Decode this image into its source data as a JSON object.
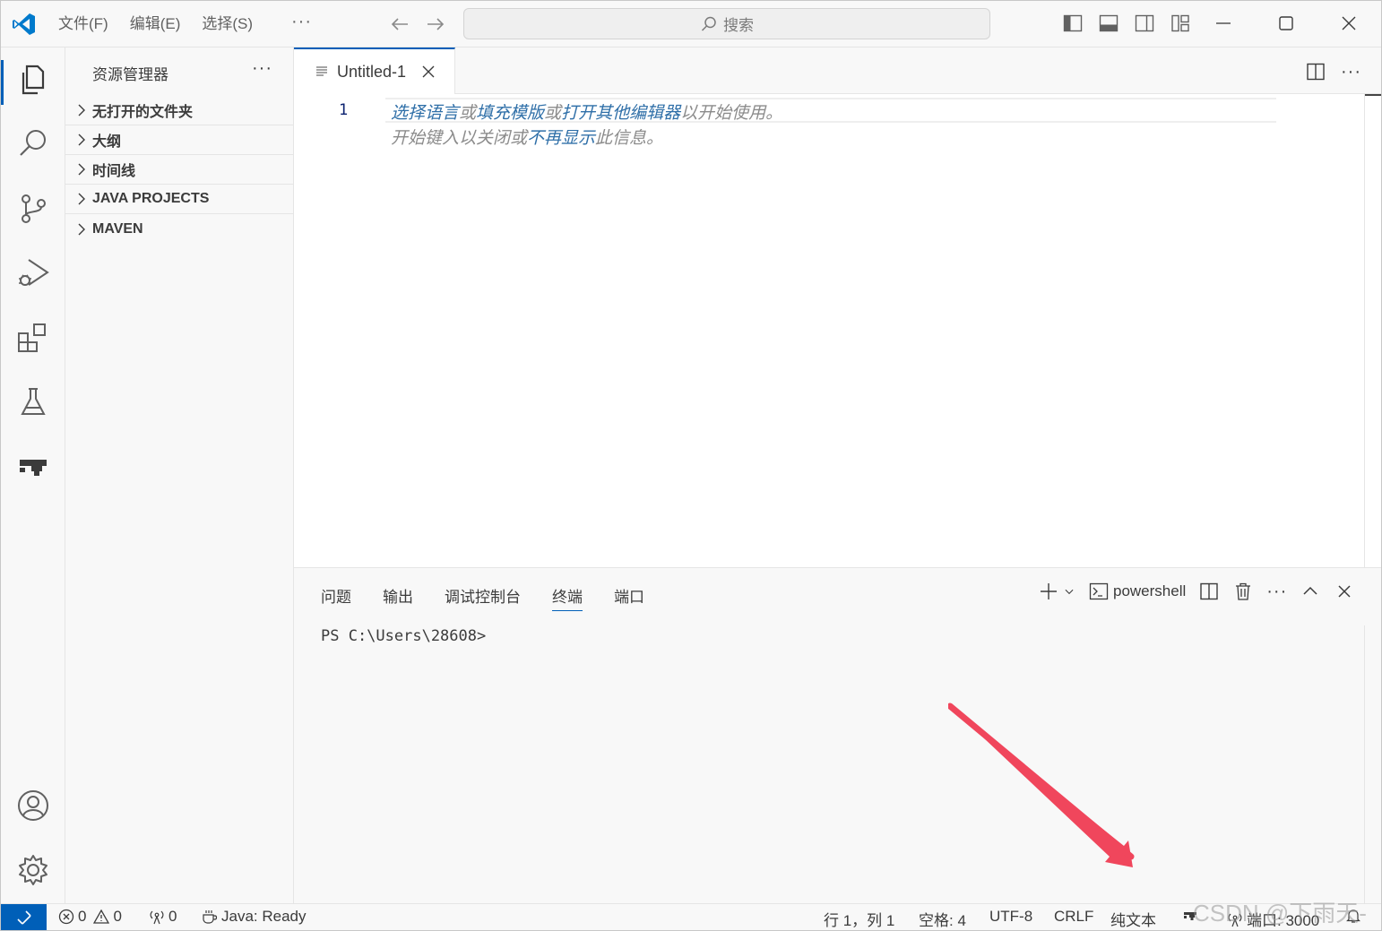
{
  "menu": {
    "file": "文件(F)",
    "edit": "编辑(E)",
    "select": "选择(S)",
    "more": "···"
  },
  "search": {
    "label": "搜索"
  },
  "sidebar": {
    "title": "资源管理器",
    "more": "···",
    "sections": [
      {
        "label": "无打开的文件夹"
      },
      {
        "label": "大纲"
      },
      {
        "label": "时间线"
      },
      {
        "label": "JAVA PROJECTS"
      },
      {
        "label": "MAVEN"
      }
    ]
  },
  "editor": {
    "tab_label": "Untitled-1",
    "line_number": "1",
    "hint_line1_link1": "选择语言",
    "hint_line1_sep1": "或",
    "hint_line1_link2": "填充模版",
    "hint_line1_sep2": "或",
    "hint_line1_link3": "打开其他编辑器",
    "hint_line1_tail": "以开始使用。",
    "hint_line2_head": "开始键入以关闭或",
    "hint_line2_link": "不再显示",
    "hint_line2_tail": "此信息。",
    "more": "···"
  },
  "panel": {
    "tabs": [
      "问题",
      "输出",
      "调试控制台",
      "终端",
      "端口"
    ],
    "active_tab": "终端",
    "shell_name": "powershell",
    "more": "···",
    "terminal_prompt": "PS C:\\Users\\28608>"
  },
  "statusbar": {
    "errors": "0",
    "warnings": "0",
    "ports_forwarded": "0",
    "java_status": "Java: Ready",
    "cursor_position": "行 1，列 1",
    "indent": "空格: 4",
    "encoding": "UTF-8",
    "eol": "CRLF",
    "language": "纯文本",
    "port": "端口: 3000"
  },
  "watermark": "CSDN @下雨天-",
  "colors": {
    "accent": "#005fb8",
    "annotation_arrow": "#f0465c",
    "logo": "#007acc"
  }
}
